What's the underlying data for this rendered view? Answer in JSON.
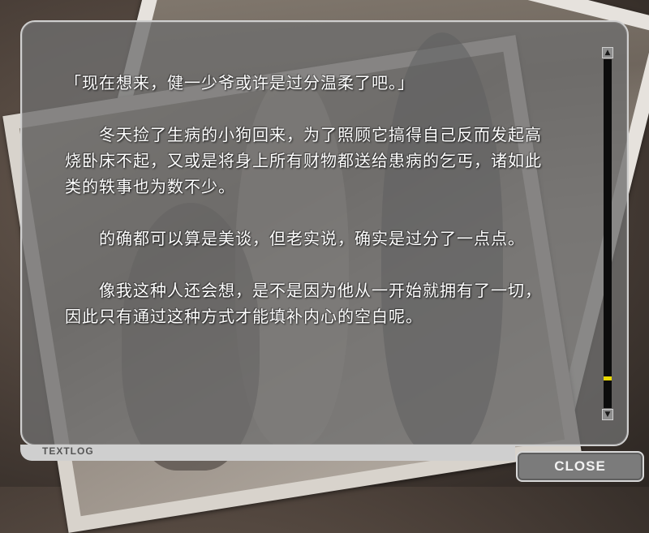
{
  "log": {
    "paragraphs": [
      "「现在想来，健一少爷或许是过分温柔了吧。」",
      "　　冬天捡了生病的小狗回来，为了照顾它搞得自己反而发起高烧卧床不起，又或是将身上所有财物都送给患病的乞丐，诸如此类的轶事也为数不少。",
      "　　的确都可以算是美谈，但老实说，确实是过分了一点点。",
      "　　像我这种人还会想，是不是因为他从一开始就拥有了一切，因此只有通过这种方式才能填补内心的空白呢。"
    ]
  },
  "scrollbar": {
    "up_icon": "▲",
    "down_icon": "▼",
    "position_fraction": 0.92,
    "thumb_color": "#e8d800"
  },
  "footer": {
    "title": "TEXTLOG",
    "close_label": "CLOSE"
  }
}
